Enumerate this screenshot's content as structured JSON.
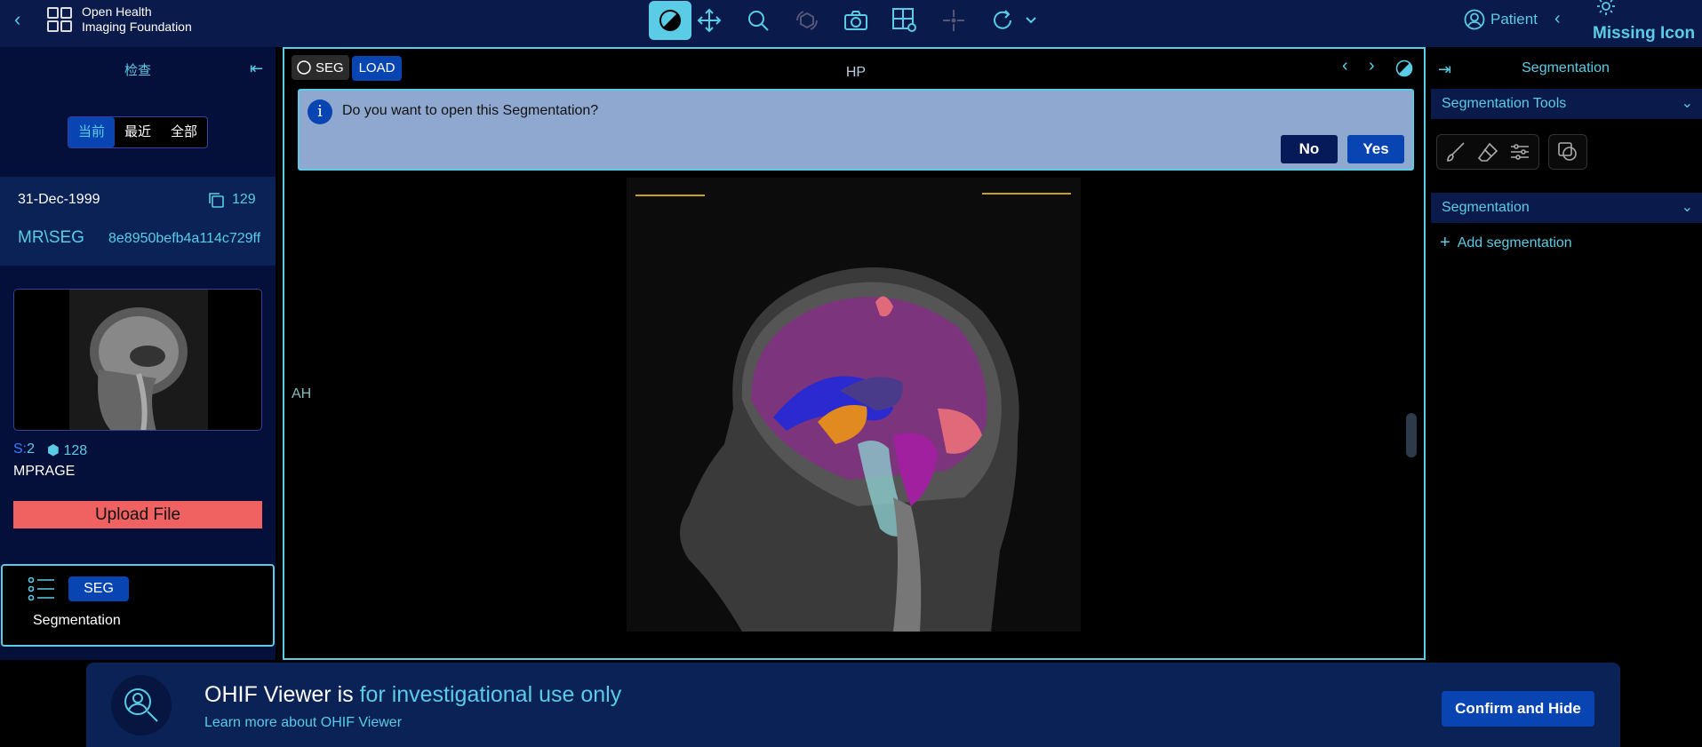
{
  "header": {
    "logo_line1": "Open Health",
    "logo_line2": "Imaging Foundation",
    "patient_label": "Patient",
    "missing_icon_text": "Missing Icon"
  },
  "left_panel": {
    "title": "检查",
    "tabs": [
      "当前",
      "最近",
      "全部"
    ],
    "active_tab": "当前",
    "study": {
      "date": "31-Dec-1999",
      "instance_count": "129",
      "modalities": "MR\\SEG",
      "uid": "8e8950befb4a114c729ff"
    },
    "series": {
      "series_label": "S:",
      "series_number": "2",
      "instances": "128",
      "description": "MPRAGE"
    },
    "upload_label": "Upload File",
    "seg_card": {
      "badge": "SEG",
      "label": "Segmentation"
    }
  },
  "viewport": {
    "seg_toggle_label": "SEG",
    "load_label": "LOAD",
    "orientation_top": "HP",
    "orientation_left": "AH",
    "dialog": {
      "message": "Do you want to open this Segmentation?",
      "no_label": "No",
      "yes_label": "Yes",
      "icon_glyph": "i"
    }
  },
  "right_panel": {
    "title": "Segmentation",
    "tools_section": "Segmentation Tools",
    "seg_section": "Segmentation",
    "add_segmentation": "Add segmentation"
  },
  "banner": {
    "main_prefix": "OHIF Viewer is ",
    "main_highlight": "for investigational use only",
    "link": "Learn more about OHIF Viewer",
    "confirm_label": "Confirm and Hide"
  },
  "colors": {
    "header_bg": "#0a1a4a",
    "accent": "#5acce6",
    "primary_button": "#0944b3",
    "upload_button": "#f06262",
    "dialog_bg": "#8ea8d0"
  }
}
